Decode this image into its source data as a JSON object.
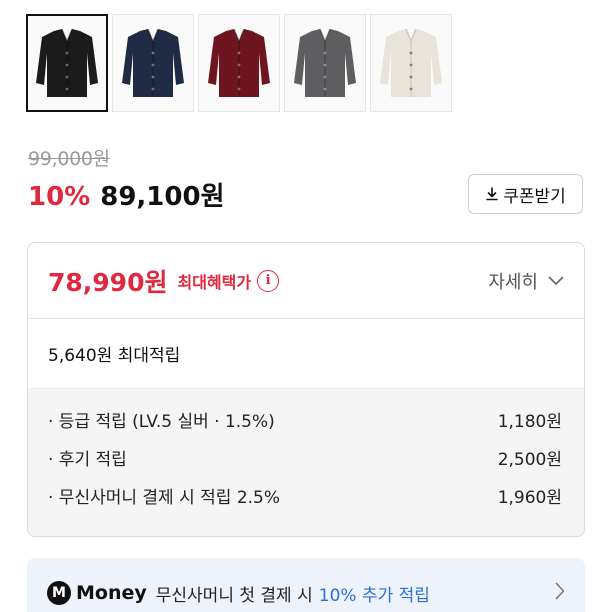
{
  "swatches": [
    {
      "color": "#1b1b1b",
      "selected": true
    },
    {
      "color": "#1f2a44",
      "selected": false
    },
    {
      "color": "#6e1620",
      "selected": false
    },
    {
      "color": "#5e5e60",
      "selected": false
    },
    {
      "color": "#e8e4d9",
      "selected": false
    }
  ],
  "pricing": {
    "original_price": "99,000원",
    "discount_rate": "10%",
    "sale_price": "89,100원",
    "coupon_label": "쿠폰받기"
  },
  "benefit": {
    "best_price": "78,990원",
    "best_label": "최대혜택가",
    "info_icon_glyph": "i",
    "detail_label": "자세히",
    "max_earn": "5,640원 최대적립",
    "earn_items": [
      {
        "label": "· 등급 적립 (LV.5 실버 · 1.5%)",
        "amount": "1,180원"
      },
      {
        "label": "· 후기 적립",
        "amount": "2,500원"
      },
      {
        "label": "· 무신사머니 결제 시 적립 2.5%",
        "amount": "1,960원"
      }
    ]
  },
  "money_banner": {
    "logo_letter": "M",
    "logo_word": "Money",
    "text": "무신사머니 첫 결제 시",
    "highlight": "10% 추가 적립"
  },
  "colors": {
    "accent_red": "#e0283f",
    "accent_blue": "#2b6fd8",
    "banner_bg": "#eef3fb"
  }
}
